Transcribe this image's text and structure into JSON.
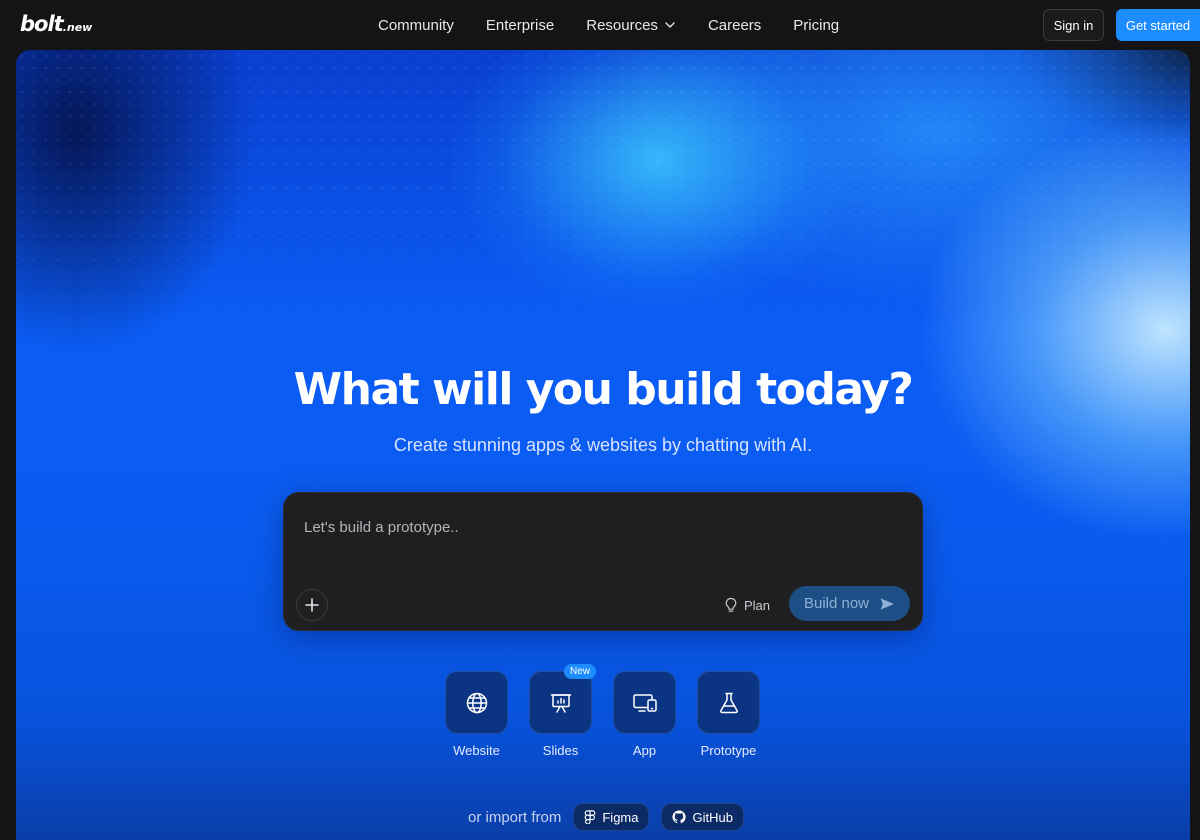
{
  "brand": {
    "logo_main": "bolt",
    "logo_suffix": ".new"
  },
  "nav": {
    "items": [
      {
        "label": "Community"
      },
      {
        "label": "Enterprise"
      },
      {
        "label": "Resources",
        "has_dropdown": true
      },
      {
        "label": "Careers"
      },
      {
        "label": "Pricing"
      }
    ],
    "sign_in": "Sign in",
    "get_started": "Get started"
  },
  "hero": {
    "title": "What will you build today?",
    "subtitle": "Create stunning apps & websites by chatting with AI."
  },
  "prompt": {
    "placeholder": "Let's build a prototype..",
    "value": "",
    "plan_label": "Plan",
    "build_label": "Build now",
    "icons": {
      "attach": "plus-icon",
      "plan": "lightbulb-icon",
      "send": "send-icon"
    }
  },
  "quick_start": [
    {
      "label": "Website",
      "icon": "globe-icon"
    },
    {
      "label": "Slides",
      "icon": "presentation-icon",
      "badge": "New"
    },
    {
      "label": "App",
      "icon": "devices-icon"
    },
    {
      "label": "Prototype",
      "icon": "flask-icon"
    }
  ],
  "import": {
    "text": "or import from",
    "sources": [
      {
        "label": "Figma",
        "icon": "figma-icon"
      },
      {
        "label": "GitHub",
        "icon": "github-icon"
      }
    ]
  },
  "colors": {
    "accent": "#1c8cff",
    "page_bg": "#141416",
    "hero_blue": "#0b5cf5",
    "prompt_bg": "#1f1f22",
    "build_button_bg": "#1d4f86",
    "tile_bg": "#0b3582"
  }
}
